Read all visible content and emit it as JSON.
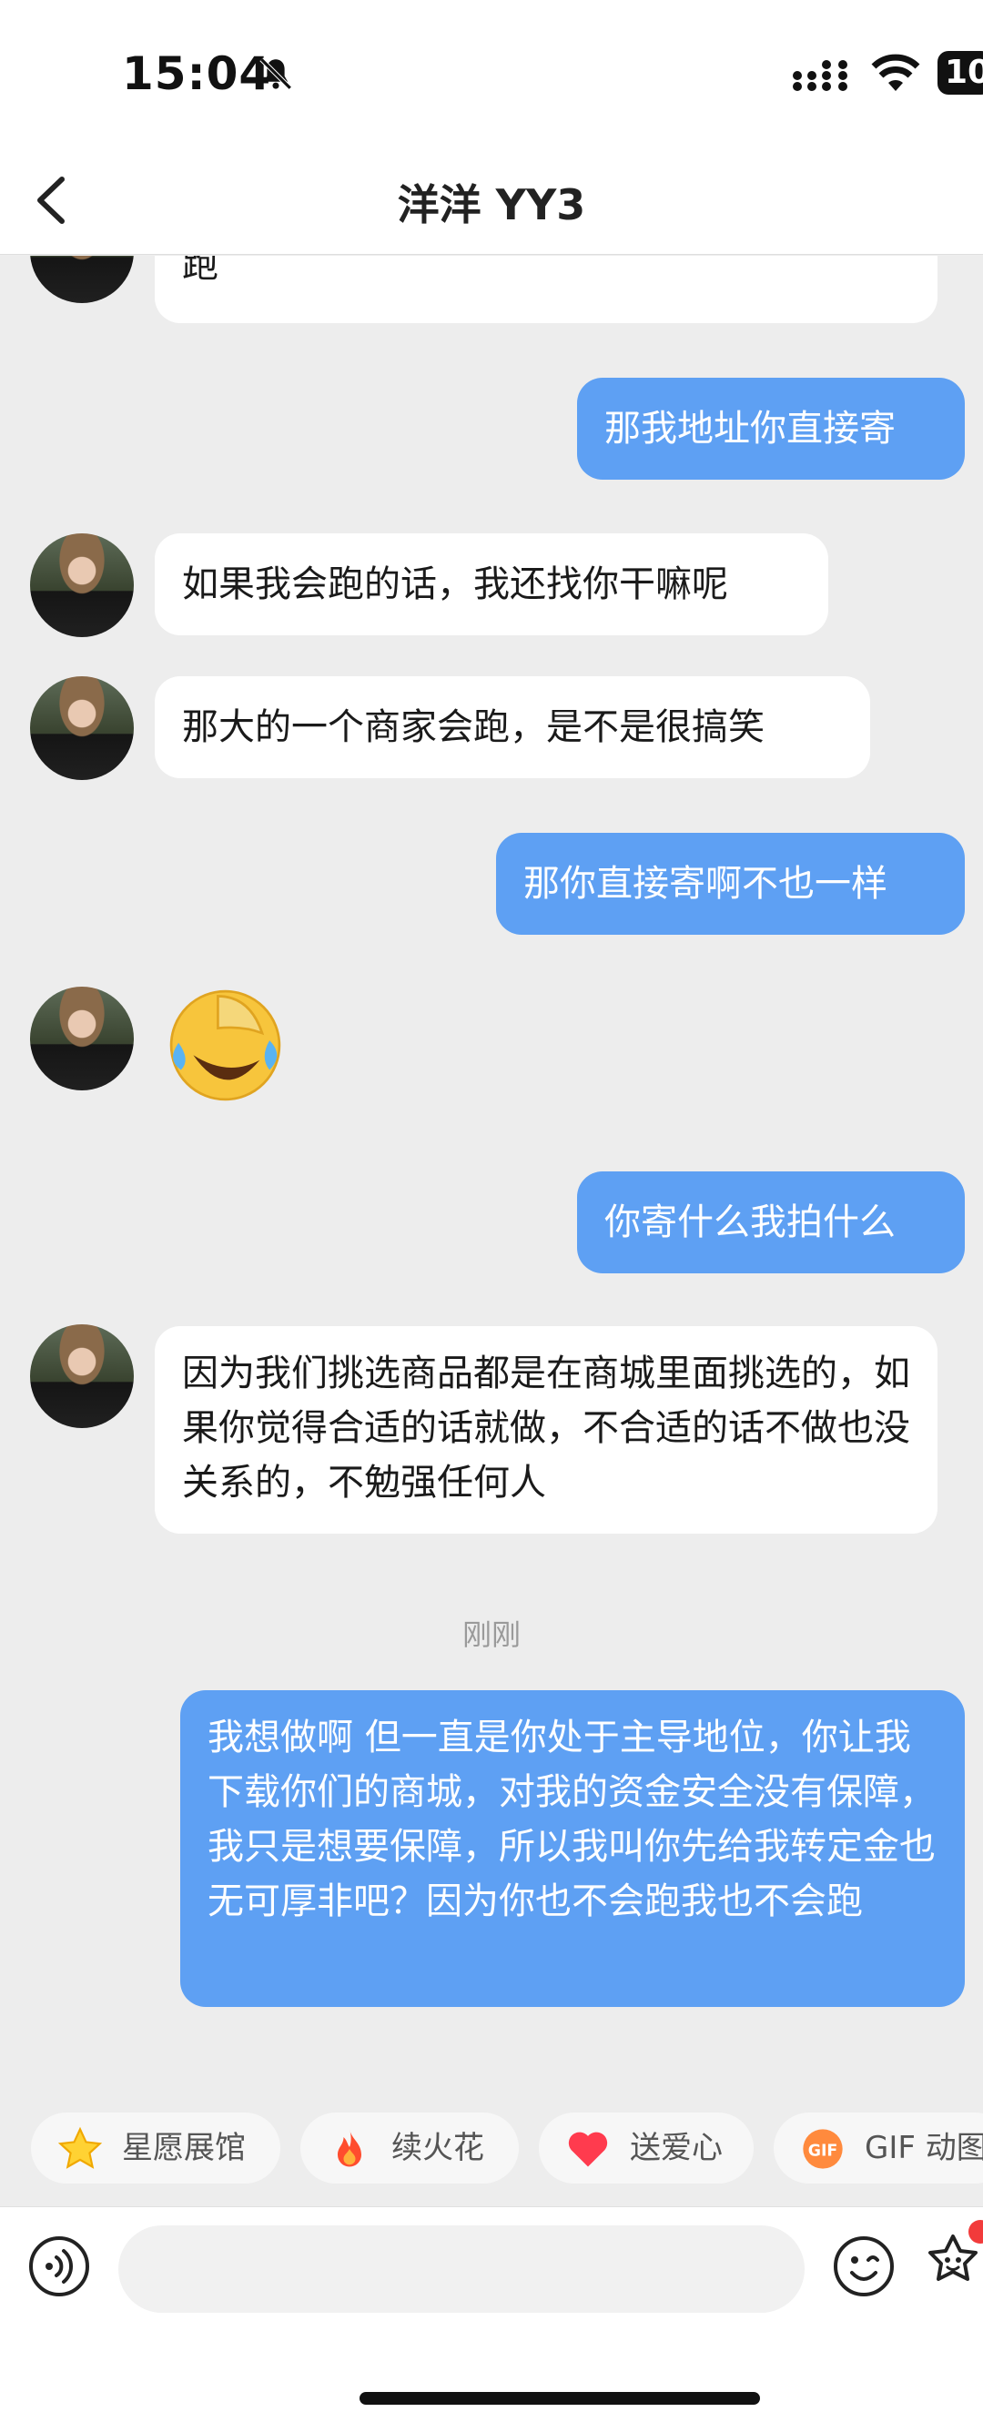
{
  "status_bar": {
    "time": "15:04",
    "battery": "10"
  },
  "header": {
    "title": "洋洋 YY3"
  },
  "messages": [
    {
      "side": "in",
      "text": "跑"
    },
    {
      "side": "out",
      "text": "那我地址你直接寄"
    },
    {
      "side": "in",
      "text": "如果我会跑的话，我还找你干嘛呢"
    },
    {
      "side": "in",
      "text": "那大的一个商家会跑，是不是很搞笑"
    },
    {
      "side": "out",
      "text": "那你直接寄啊不也一样"
    },
    {
      "side": "in",
      "type": "emoji",
      "emoji": "rolling-on-floor-laughing"
    },
    {
      "side": "out",
      "text": "你寄什么我拍什么"
    },
    {
      "side": "in",
      "text": "因为我们挑选商品都是在商城里面挑选的，如果你觉得合适的话就做，不合适的话不做也没关系的，不勉强任何人"
    },
    {
      "side": "out",
      "text": "我想做啊 但一直是你处于主导地位，你让我下载你们的商城，对我的资金安全没有保障，我只是想要保障，所以我叫你先给我转定金也无可厚非吧？因为你也不会跑我也不会跑"
    }
  ],
  "timestamp": "刚刚",
  "quick_actions": [
    {
      "label": "星愿展馆",
      "icon": "star-icon"
    },
    {
      "label": "续火花",
      "icon": "fire-icon"
    },
    {
      "label": "送爱心",
      "icon": "heart-icon"
    },
    {
      "label": "GIF 动图",
      "icon": "gif-icon"
    }
  ],
  "input": {
    "placeholder": ""
  },
  "colors": {
    "bubble_out": "#5ea0f3",
    "bubble_in": "#ffffff",
    "background": "#ededed"
  }
}
